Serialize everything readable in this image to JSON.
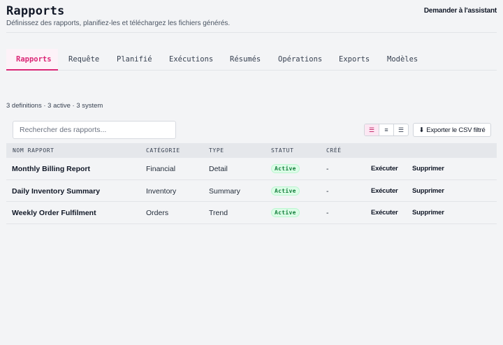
{
  "header": {
    "title": "Rapports",
    "subtitle": "Définissez des rapports, planifiez-les et téléchargez les fichiers générés.",
    "assistant_label": "Demander à l'assistant"
  },
  "tabs": [
    {
      "label": "Rapports",
      "active": true
    },
    {
      "label": "Requête",
      "active": false
    },
    {
      "label": "Planifié",
      "active": false
    },
    {
      "label": "Exécutions",
      "active": false
    },
    {
      "label": "Résumés",
      "active": false
    },
    {
      "label": "Opérations",
      "active": false
    },
    {
      "label": "Exports",
      "active": false
    },
    {
      "label": "Modèles",
      "active": false
    }
  ],
  "summary": "3 definitions · 3 active · 3 system",
  "search": {
    "placeholder": "Rechercher des rapports...",
    "value": ""
  },
  "view_toggle": [
    {
      "icon": "list-view-icon",
      "glyph": "☰",
      "active": true
    },
    {
      "icon": "compact-view-icon",
      "glyph": "≡",
      "active": false
    },
    {
      "icon": "dense-view-icon",
      "glyph": "☰",
      "active": false
    }
  ],
  "export": {
    "icon": "download-icon",
    "glyph": "⬇",
    "label": "Exporter le CSV filtré"
  },
  "table": {
    "columns": [
      "Nom rapport",
      "Catégorie",
      "Type",
      "Statut",
      "Créé"
    ],
    "rows": [
      {
        "name": "Monthly Billing Report",
        "category": "Financial",
        "type": "Detail",
        "status": "Active",
        "created": "-",
        "run_label": "Exécuter",
        "delete_label": "Supprimer"
      },
      {
        "name": "Daily Inventory Summary",
        "category": "Inventory",
        "type": "Summary",
        "status": "Active",
        "created": "-",
        "run_label": "Exécuter",
        "delete_label": "Supprimer"
      },
      {
        "name": "Weekly Order Fulfilment",
        "category": "Orders",
        "type": "Trend",
        "status": "Active",
        "created": "-",
        "run_label": "Exécuter",
        "delete_label": "Supprimer"
      }
    ]
  },
  "colors": {
    "accent": "#db2777",
    "status_active": "#15803d"
  }
}
